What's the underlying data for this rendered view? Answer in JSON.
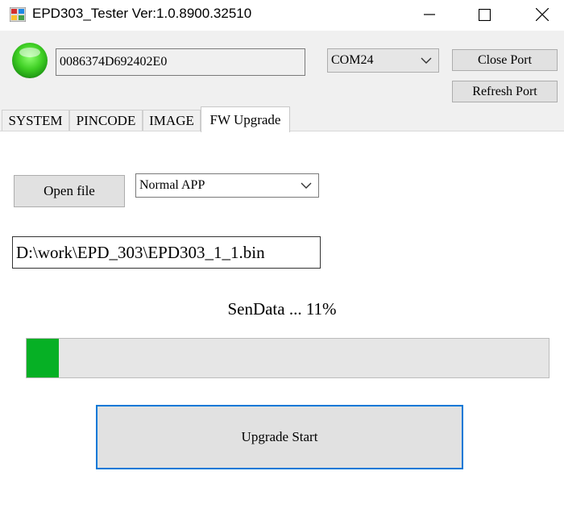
{
  "window": {
    "title": "EPD303_Tester Ver:1.0.8900.32510",
    "controls": [
      "minimize-icon",
      "maximize-icon",
      "close-icon"
    ]
  },
  "connection": {
    "status_led_color": "#3fcf24",
    "device_id": "0086374D692402E0",
    "port": "COM24",
    "close_port_label": "Close Port",
    "refresh_port_label": "Refresh Port"
  },
  "tabs": [
    {
      "label": "SYSTEM",
      "active": false
    },
    {
      "label": "PINCODE",
      "active": false
    },
    {
      "label": "IMAGE",
      "active": false
    },
    {
      "label": "FW Upgrade",
      "active": true
    }
  ],
  "fw_upgrade": {
    "open_file_label": "Open file",
    "mode": "Normal APP",
    "file_path": "D:\\work\\EPD_303\\EPD303_1_1.bin",
    "status_text": "SenData ... 11%",
    "progress_fraction": 0.11,
    "progress_color": "#06b025",
    "upgrade_start_label": "Upgrade Start"
  }
}
